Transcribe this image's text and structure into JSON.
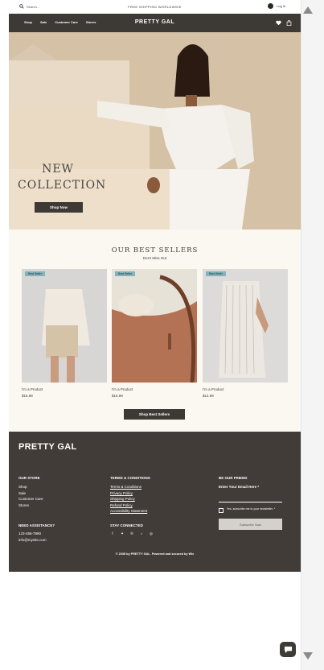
{
  "topbar": {
    "search_placeholder": "Search...",
    "shipping": "FREE SHIPPING WORLDWIDE",
    "login": "Log In"
  },
  "nav": {
    "items": [
      "Shop",
      "Sale",
      "Customer Care",
      "Stores"
    ],
    "brand": "PRETTY GAL",
    "icons": [
      "heart-icon",
      "bag-icon"
    ]
  },
  "hero": {
    "title_line1": "NEW",
    "title_line2": "COLLECTION",
    "button": "Shop Now"
  },
  "best_sellers": {
    "title": "OUR BEST SELLERS",
    "subtitle": "Don't Miss Out",
    "products": [
      {
        "badge": "Best Seller",
        "name": "I'm a Product",
        "price": "$15.99"
      },
      {
        "badge": "Best Seller",
        "name": "I'm a Product",
        "price": "$16.99"
      },
      {
        "badge": "Best Seller",
        "name": "I'm a Product",
        "price": "$14.99"
      }
    ],
    "button": "Shop Best Sellers"
  },
  "footer": {
    "brand": "PRETTY GAL",
    "store_heading": "OUR STORE",
    "store_links": [
      "Shop",
      "Sale",
      "Customer Care",
      "Stores"
    ],
    "terms_heading": "TERMS & CONDITIONS",
    "terms_links": [
      "Terms & Conditions",
      "Privacy Policy",
      "Shipping Policy",
      "Refund Policy",
      "Accessibility Statement"
    ],
    "friend_heading": "BE OUR FRIEND",
    "email_label": "Enter Your Email Here *",
    "checkbox_text": "Yes, subscribe me to your newsletter. *",
    "subscribe_button": "Subscribe Now",
    "assist_heading": "NEED ASSISTANCE?",
    "phone": "123-456-7890",
    "email": "info@mysite.com",
    "connect_heading": "STAY CONNECTED",
    "social_icons": [
      "facebook-icon",
      "twitter-icon",
      "pinterest-icon",
      "tiktok-icon",
      "instagram-icon"
    ],
    "copyright": "© 2035 by PRETTY GAL. Powered and secured by Wix"
  },
  "colors": {
    "dark": "#3d3935",
    "footer": "#413c38",
    "hero_bg": "#d9c7ae",
    "section_bg": "#fbf8f1",
    "badge": "#82b4bf"
  }
}
